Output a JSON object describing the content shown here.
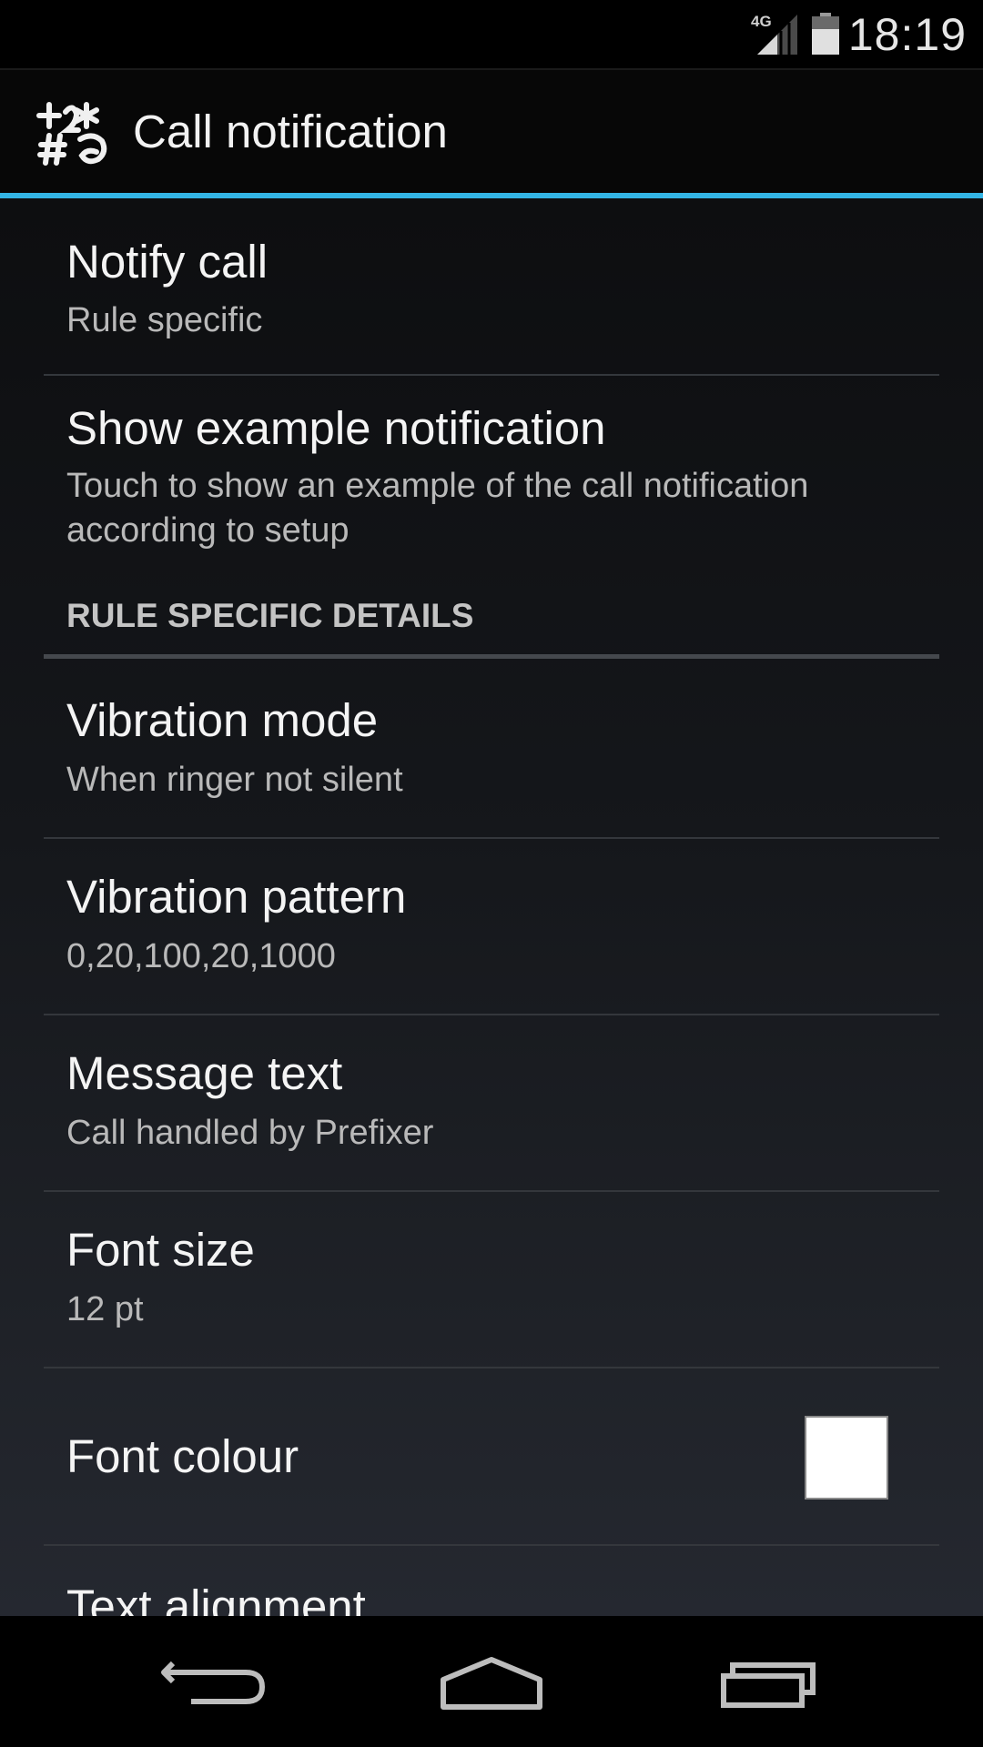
{
  "status_bar": {
    "network_label": "4G",
    "time": "18:19",
    "signal_icon": "signal-icon",
    "battery_icon": "battery-icon"
  },
  "action_bar": {
    "app_icon": "prefixer-app-icon",
    "title": "Call notification",
    "accent_color": "#33b5e5"
  },
  "preferences": {
    "notify_call": {
      "title": "Notify call",
      "summary": "Rule specific"
    },
    "show_example": {
      "title": "Show example notification",
      "summary": "Touch to show an example of the call notification according to setup"
    },
    "category": {
      "title": "RULE SPECIFIC DETAILS"
    },
    "vibration_mode": {
      "title": "Vibration mode",
      "summary": "When ringer not silent"
    },
    "vibration_pattern": {
      "title": "Vibration pattern",
      "summary": "0,20,100,20,1000"
    },
    "message_text": {
      "title": "Message text",
      "summary": "Call handled by Prefixer"
    },
    "font_size": {
      "title": "Font size",
      "summary": "12 pt"
    },
    "font_colour": {
      "title": "Font colour",
      "swatch_color": "#ffffff"
    },
    "text_alignment": {
      "title": "Text alignment"
    }
  },
  "nav_bar": {
    "back_icon": "back-icon",
    "home_icon": "home-icon",
    "recents_icon": "recent-apps-icon"
  }
}
